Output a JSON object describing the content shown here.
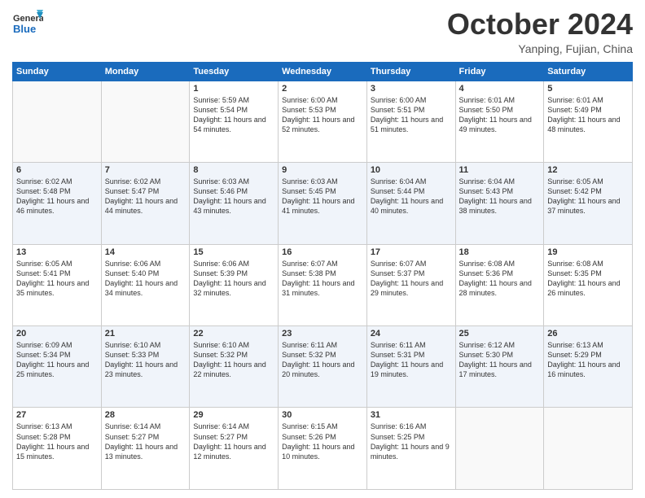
{
  "header": {
    "logo_general": "General",
    "logo_blue": "Blue",
    "month": "October 2024",
    "location": "Yanping, Fujian, China"
  },
  "weekdays": [
    "Sunday",
    "Monday",
    "Tuesday",
    "Wednesday",
    "Thursday",
    "Friday",
    "Saturday"
  ],
  "weeks": [
    [
      {
        "day": "",
        "sunrise": "",
        "sunset": "",
        "daylight": ""
      },
      {
        "day": "",
        "sunrise": "",
        "sunset": "",
        "daylight": ""
      },
      {
        "day": "1",
        "sunrise": "Sunrise: 5:59 AM",
        "sunset": "Sunset: 5:54 PM",
        "daylight": "Daylight: 11 hours and 54 minutes."
      },
      {
        "day": "2",
        "sunrise": "Sunrise: 6:00 AM",
        "sunset": "Sunset: 5:53 PM",
        "daylight": "Daylight: 11 hours and 52 minutes."
      },
      {
        "day": "3",
        "sunrise": "Sunrise: 6:00 AM",
        "sunset": "Sunset: 5:51 PM",
        "daylight": "Daylight: 11 hours and 51 minutes."
      },
      {
        "day": "4",
        "sunrise": "Sunrise: 6:01 AM",
        "sunset": "Sunset: 5:50 PM",
        "daylight": "Daylight: 11 hours and 49 minutes."
      },
      {
        "day": "5",
        "sunrise": "Sunrise: 6:01 AM",
        "sunset": "Sunset: 5:49 PM",
        "daylight": "Daylight: 11 hours and 48 minutes."
      }
    ],
    [
      {
        "day": "6",
        "sunrise": "Sunrise: 6:02 AM",
        "sunset": "Sunset: 5:48 PM",
        "daylight": "Daylight: 11 hours and 46 minutes."
      },
      {
        "day": "7",
        "sunrise": "Sunrise: 6:02 AM",
        "sunset": "Sunset: 5:47 PM",
        "daylight": "Daylight: 11 hours and 44 minutes."
      },
      {
        "day": "8",
        "sunrise": "Sunrise: 6:03 AM",
        "sunset": "Sunset: 5:46 PM",
        "daylight": "Daylight: 11 hours and 43 minutes."
      },
      {
        "day": "9",
        "sunrise": "Sunrise: 6:03 AM",
        "sunset": "Sunset: 5:45 PM",
        "daylight": "Daylight: 11 hours and 41 minutes."
      },
      {
        "day": "10",
        "sunrise": "Sunrise: 6:04 AM",
        "sunset": "Sunset: 5:44 PM",
        "daylight": "Daylight: 11 hours and 40 minutes."
      },
      {
        "day": "11",
        "sunrise": "Sunrise: 6:04 AM",
        "sunset": "Sunset: 5:43 PM",
        "daylight": "Daylight: 11 hours and 38 minutes."
      },
      {
        "day": "12",
        "sunrise": "Sunrise: 6:05 AM",
        "sunset": "Sunset: 5:42 PM",
        "daylight": "Daylight: 11 hours and 37 minutes."
      }
    ],
    [
      {
        "day": "13",
        "sunrise": "Sunrise: 6:05 AM",
        "sunset": "Sunset: 5:41 PM",
        "daylight": "Daylight: 11 hours and 35 minutes."
      },
      {
        "day": "14",
        "sunrise": "Sunrise: 6:06 AM",
        "sunset": "Sunset: 5:40 PM",
        "daylight": "Daylight: 11 hours and 34 minutes."
      },
      {
        "day": "15",
        "sunrise": "Sunrise: 6:06 AM",
        "sunset": "Sunset: 5:39 PM",
        "daylight": "Daylight: 11 hours and 32 minutes."
      },
      {
        "day": "16",
        "sunrise": "Sunrise: 6:07 AM",
        "sunset": "Sunset: 5:38 PM",
        "daylight": "Daylight: 11 hours and 31 minutes."
      },
      {
        "day": "17",
        "sunrise": "Sunrise: 6:07 AM",
        "sunset": "Sunset: 5:37 PM",
        "daylight": "Daylight: 11 hours and 29 minutes."
      },
      {
        "day": "18",
        "sunrise": "Sunrise: 6:08 AM",
        "sunset": "Sunset: 5:36 PM",
        "daylight": "Daylight: 11 hours and 28 minutes."
      },
      {
        "day": "19",
        "sunrise": "Sunrise: 6:08 AM",
        "sunset": "Sunset: 5:35 PM",
        "daylight": "Daylight: 11 hours and 26 minutes."
      }
    ],
    [
      {
        "day": "20",
        "sunrise": "Sunrise: 6:09 AM",
        "sunset": "Sunset: 5:34 PM",
        "daylight": "Daylight: 11 hours and 25 minutes."
      },
      {
        "day": "21",
        "sunrise": "Sunrise: 6:10 AM",
        "sunset": "Sunset: 5:33 PM",
        "daylight": "Daylight: 11 hours and 23 minutes."
      },
      {
        "day": "22",
        "sunrise": "Sunrise: 6:10 AM",
        "sunset": "Sunset: 5:32 PM",
        "daylight": "Daylight: 11 hours and 22 minutes."
      },
      {
        "day": "23",
        "sunrise": "Sunrise: 6:11 AM",
        "sunset": "Sunset: 5:32 PM",
        "daylight": "Daylight: 11 hours and 20 minutes."
      },
      {
        "day": "24",
        "sunrise": "Sunrise: 6:11 AM",
        "sunset": "Sunset: 5:31 PM",
        "daylight": "Daylight: 11 hours and 19 minutes."
      },
      {
        "day": "25",
        "sunrise": "Sunrise: 6:12 AM",
        "sunset": "Sunset: 5:30 PM",
        "daylight": "Daylight: 11 hours and 17 minutes."
      },
      {
        "day": "26",
        "sunrise": "Sunrise: 6:13 AM",
        "sunset": "Sunset: 5:29 PM",
        "daylight": "Daylight: 11 hours and 16 minutes."
      }
    ],
    [
      {
        "day": "27",
        "sunrise": "Sunrise: 6:13 AM",
        "sunset": "Sunset: 5:28 PM",
        "daylight": "Daylight: 11 hours and 15 minutes."
      },
      {
        "day": "28",
        "sunrise": "Sunrise: 6:14 AM",
        "sunset": "Sunset: 5:27 PM",
        "daylight": "Daylight: 11 hours and 13 minutes."
      },
      {
        "day": "29",
        "sunrise": "Sunrise: 6:14 AM",
        "sunset": "Sunset: 5:27 PM",
        "daylight": "Daylight: 11 hours and 12 minutes."
      },
      {
        "day": "30",
        "sunrise": "Sunrise: 6:15 AM",
        "sunset": "Sunset: 5:26 PM",
        "daylight": "Daylight: 11 hours and 10 minutes."
      },
      {
        "day": "31",
        "sunrise": "Sunrise: 6:16 AM",
        "sunset": "Sunset: 5:25 PM",
        "daylight": "Daylight: 11 hours and 9 minutes."
      },
      {
        "day": "",
        "sunrise": "",
        "sunset": "",
        "daylight": ""
      },
      {
        "day": "",
        "sunrise": "",
        "sunset": "",
        "daylight": ""
      }
    ]
  ]
}
